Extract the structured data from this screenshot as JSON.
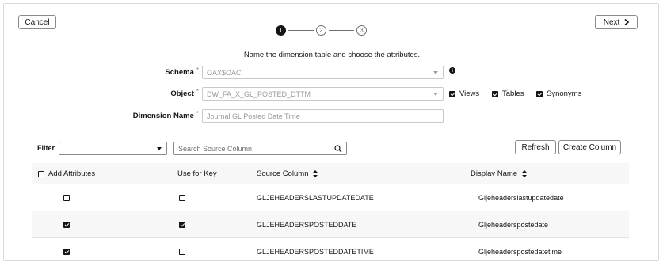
{
  "toolbar": {
    "cancel_label": "Cancel",
    "next_label": "Next"
  },
  "steps": [
    "1",
    "2",
    "3"
  ],
  "instruction": "Name the dimension table and choose the attributes.",
  "form": {
    "schema": {
      "label": "Schema",
      "value": "OAX$OAC"
    },
    "object": {
      "label": "Object",
      "value": "DW_FA_X_GL_POSTED_DTTM"
    },
    "dimension_name": {
      "label": "Dimension Name",
      "placeholder": "Journal GL Posted Date Time"
    },
    "required_mark": "*",
    "info_glyph": "i",
    "object_types": {
      "views": "Views",
      "tables": "Tables",
      "synonyms": "Synonyms"
    }
  },
  "filter": {
    "label": "Filter",
    "search_placeholder": "Search Source Column",
    "refresh_label": "Refresh",
    "create_label": "Create Column"
  },
  "grid": {
    "headers": {
      "add_attributes": "Add Attributes",
      "use_for_key": "Use for Key",
      "source_column": "Source Column",
      "display_name": "Display Name"
    },
    "rows": [
      {
        "add": false,
        "key": false,
        "source": "GLJEHEADERSLASTUPDATEDATE",
        "display": "Gljeheaderslastupdatedate"
      },
      {
        "add": true,
        "key": true,
        "source": "GLJEHEADERSPOSTEDDATE",
        "display": "Gljeheaderspostedate"
      },
      {
        "add": true,
        "key": false,
        "source": "GLJEHEADERSPOSTEDDATETIME",
        "display": "Gljeheaderspostedatetime"
      }
    ]
  }
}
